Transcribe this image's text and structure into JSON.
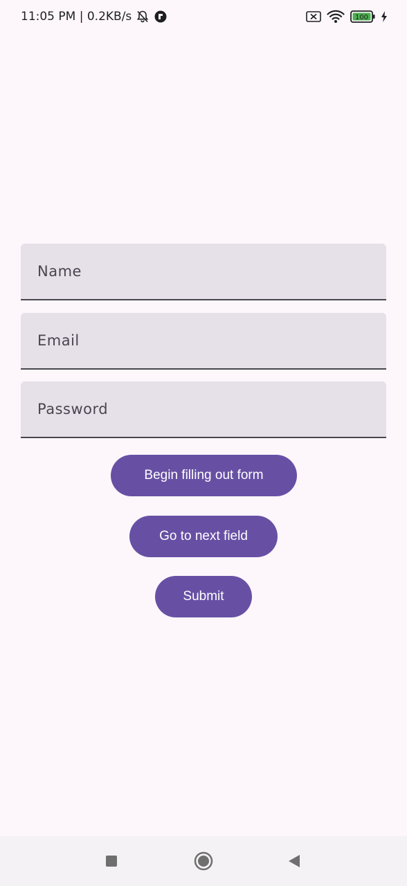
{
  "status_bar": {
    "time": "11:05 PM | 0.2KB/s",
    "icons": [
      "bell-off-icon",
      "app-notification-icon",
      "no-sim-icon",
      "wifi-icon",
      "battery-icon",
      "charging-icon"
    ],
    "battery_level": "100",
    "battery_color": "#4caf50"
  },
  "form": {
    "name_label": "Name",
    "email_label": "Email",
    "password_label": "Password"
  },
  "buttons": {
    "begin": "Begin filling out form",
    "next": "Go to next field",
    "submit": "Submit"
  },
  "colors": {
    "accent": "#6750a4",
    "field_bg": "#e6e0e9",
    "background": "#fdf7fc"
  },
  "nav_bar": {
    "icons": [
      "recents-icon",
      "home-icon",
      "back-icon"
    ]
  }
}
